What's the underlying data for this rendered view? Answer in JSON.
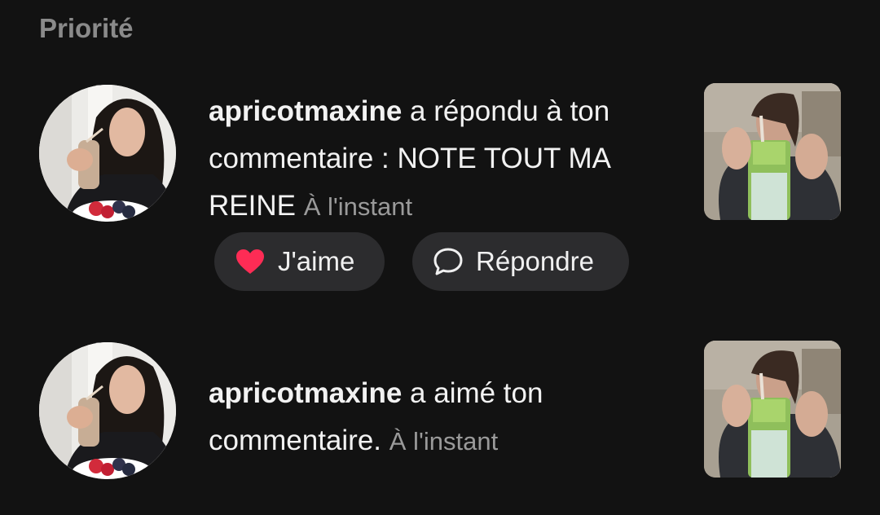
{
  "section": {
    "title": "Priorité"
  },
  "notifications": [
    {
      "username": "apricotmaxine",
      "message": " a répondu à ton commentaire : NOTE TOUT MA REINE",
      "time": "À l'instant",
      "actions": {
        "like_label": "J'aime",
        "reply_label": "Répondre"
      }
    },
    {
      "username": "apricotmaxine",
      "message": " a aimé ton commentaire.",
      "time": "À l'instant"
    }
  ],
  "colors": {
    "background": "#121212",
    "heart": "#fe2c55",
    "pill": "#2c2c2e",
    "muted_text": "#9a9a9a"
  },
  "icons": [
    "heart-icon",
    "comment-bubble-icon"
  ]
}
